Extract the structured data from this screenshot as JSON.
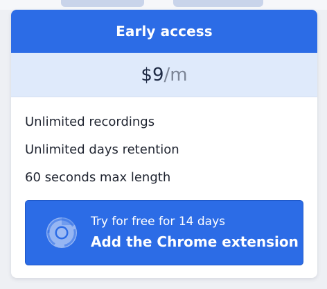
{
  "plan": {
    "title": "Early access",
    "price": {
      "amount": "$9",
      "separator": "/",
      "period": "m"
    },
    "features": [
      "Unlimited recordings",
      "Unlimited days retention",
      "60 seconds max length"
    ],
    "cta": {
      "subtitle": "Try for free for 14 days",
      "label": "Add the Chrome extension",
      "icon": "chrome-icon"
    }
  },
  "colors": {
    "accent": "#2c6ce6",
    "price_band": "#dfeafb",
    "text": "#1f2430"
  }
}
